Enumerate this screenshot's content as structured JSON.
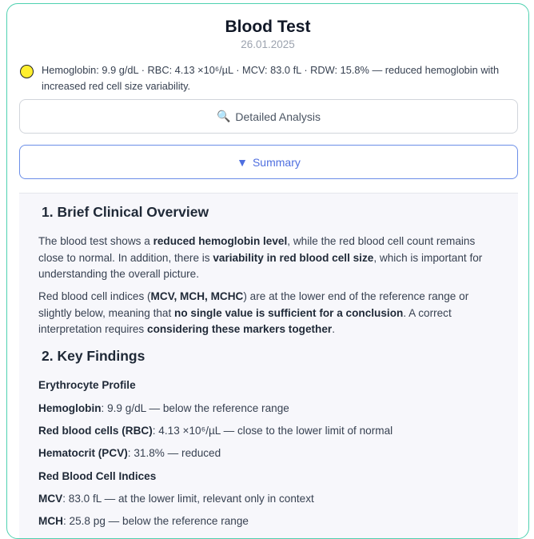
{
  "header": {
    "title": "Blood Test",
    "date": "26.01.2025"
  },
  "status": {
    "color": "#ffef2e",
    "text": "Hemoglobin: 9.9 g/dL · RBC: 4.13 ×10⁶/µL · MCV: 83.0 fL · RDW: 15.8% — reduced hemoglobin with increased red cell size variability."
  },
  "buttons": {
    "analysis_icon": "🔍",
    "analysis_label": "Detailed Analysis",
    "summary_icon": "▼",
    "summary_label": "Summary"
  },
  "overview": {
    "heading": "1. Brief Clinical Overview",
    "p1": {
      "a": "The blood test shows a ",
      "b": "reduced hemoglobin level",
      "c": ", while the red blood cell count remains close to normal. In addition, there is ",
      "d": "variability in red blood cell size",
      "e": ", which is important for understanding the overall picture."
    },
    "p2": {
      "a": "Red blood cell indices (",
      "b": "MCV, MCH, MCHC",
      "c": ") are at the lower end of the reference range or slightly below, meaning that ",
      "d": "no single value is sufficient for a conclusion",
      "e": ". A correct interpretation requires ",
      "f": "considering these markers together",
      "g": "."
    }
  },
  "findings": {
    "heading": "2. Key Findings",
    "erythrocyte_title": "Erythrocyte Profile",
    "rows": [
      {
        "name": "Hemoglobin",
        "rest": ": 9.9 g/dL — below the reference range"
      },
      {
        "name": "Red blood cells (RBC)",
        "rest": ": 4.13 ×10⁶/µL — close to the lower limit of normal"
      },
      {
        "name": "Hematocrit (PCV)",
        "rest": ": 31.8% — reduced"
      }
    ],
    "indices_title": "Red Blood Cell Indices",
    "index_rows": [
      {
        "name": "MCV",
        "rest": ": 83.0 fL — at the lower limit, relevant only in context"
      },
      {
        "name": "MCH",
        "rest": ": 25.8 pg — below the reference range"
      }
    ]
  }
}
